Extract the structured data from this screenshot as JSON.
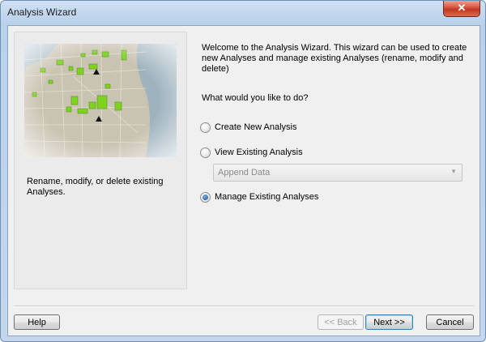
{
  "window": {
    "title": "Analysis Wizard",
    "close_glyph": "✕"
  },
  "left": {
    "description": "Rename, modify, or delete existing Analyses."
  },
  "intro": "Welcome to the Analysis Wizard.  This wizard can be used to create new Analyses and manage existing Analyses (rename, modify and delete)",
  "question": "What would you like to do?",
  "options": [
    {
      "label": "Create New Analysis",
      "selected": false
    },
    {
      "label": "View Existing Analysis",
      "selected": false
    },
    {
      "label": "Manage Existing Analyses",
      "selected": true
    }
  ],
  "analysis_select": {
    "value": "Append Data",
    "disabled": true
  },
  "buttons": {
    "help": "Help",
    "back": "<< Back",
    "next": "Next >>",
    "cancel": "Cancel"
  }
}
